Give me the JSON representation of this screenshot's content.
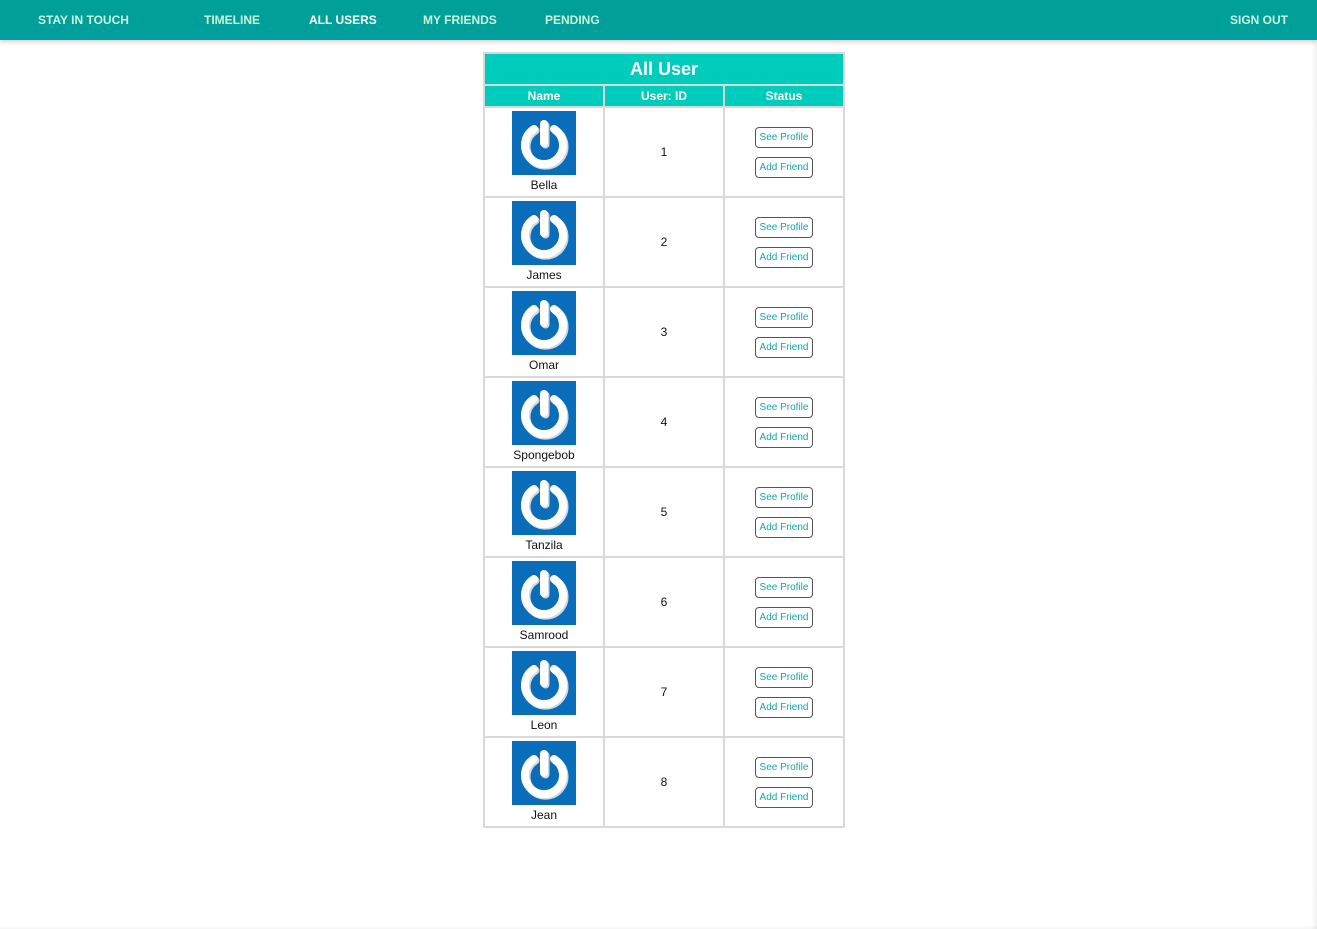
{
  "nav": {
    "brand": "STAY IN TOUCH",
    "timeline": "TIMELINE",
    "all_users": "ALL USERS",
    "my_friends": "MY FRIENDS",
    "pending": "PENDING",
    "sign_out": "SIGN OUT"
  },
  "table": {
    "title": "All User",
    "headers": {
      "name": "Name",
      "id": "User: ID",
      "status": "Status"
    },
    "actions": {
      "see_profile": "See Profile",
      "add_friend": "Add Friend"
    },
    "users": [
      {
        "name": "Bella",
        "id": "1"
      },
      {
        "name": "James",
        "id": "2"
      },
      {
        "name": "Omar",
        "id": "3"
      },
      {
        "name": "Spongebob",
        "id": "4"
      },
      {
        "name": "Tanzila",
        "id": "5"
      },
      {
        "name": "Samrood",
        "id": "6"
      },
      {
        "name": "Leon",
        "id": "7"
      },
      {
        "name": "Jean",
        "id": "8"
      }
    ]
  },
  "colors": {
    "navbar": "#009f9a",
    "table_header": "#00ccbb",
    "avatar": "#0a6dba",
    "button_text": "#1aa5a0"
  },
  "icons": {
    "avatar": "power-icon"
  }
}
